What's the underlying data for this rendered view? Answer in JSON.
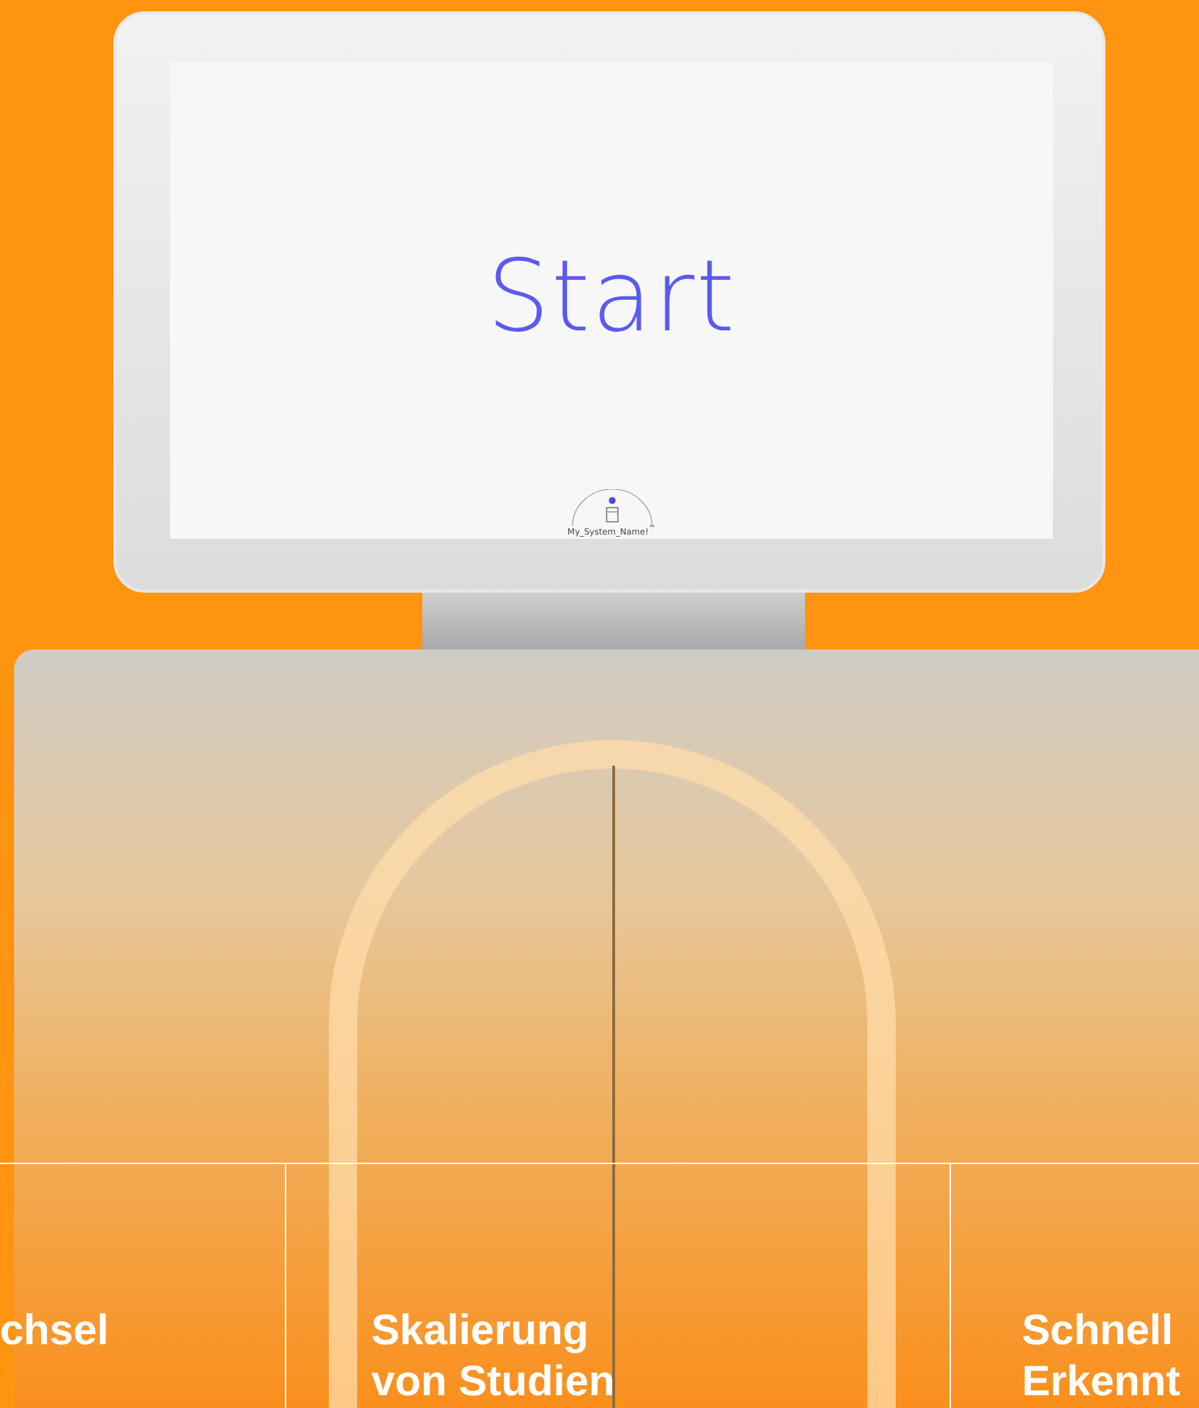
{
  "screen": {
    "title": "Start",
    "logo_text": "My_System_Name!$^{™}$"
  },
  "features": [
    {
      "lines": [
        "chsel"
      ]
    },
    {
      "lines": [
        "Skalierung",
        "von Studien"
      ]
    },
    {
      "lines": [
        "Schnell",
        "Erkennt"
      ]
    }
  ]
}
